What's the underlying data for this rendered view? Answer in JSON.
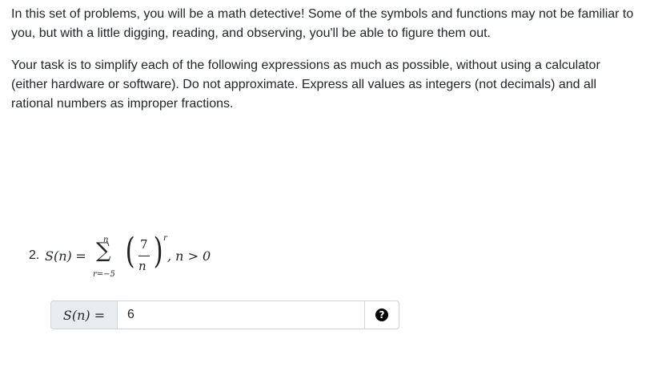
{
  "intro": {
    "paragraph1": "In this set of problems, you will be a math detective! Some of the symbols and functions may not be familiar to you, but with a little digging, reading, and observing, you'll be able to figure them out.",
    "paragraph2": "Your task is to simplify each of the following expressions as much as possible, without using a calculator (either hardware or software). Do not approximate. Express all values as integers (not decimals) and all rational numbers as improper fractions."
  },
  "problem": {
    "number": "2.",
    "lhs_func": "S",
    "lhs_arg": "(n)",
    "equals": "=",
    "sum_symbol": "∑",
    "sum_upper": "n",
    "sum_lower": "r=−5",
    "frac_numerator": "7",
    "frac_denominator": "n",
    "exponent": "r",
    "condition": ", n > 0"
  },
  "answer": {
    "label": "S(n) =",
    "value": "6",
    "help_icon": "question-circle-icon"
  }
}
